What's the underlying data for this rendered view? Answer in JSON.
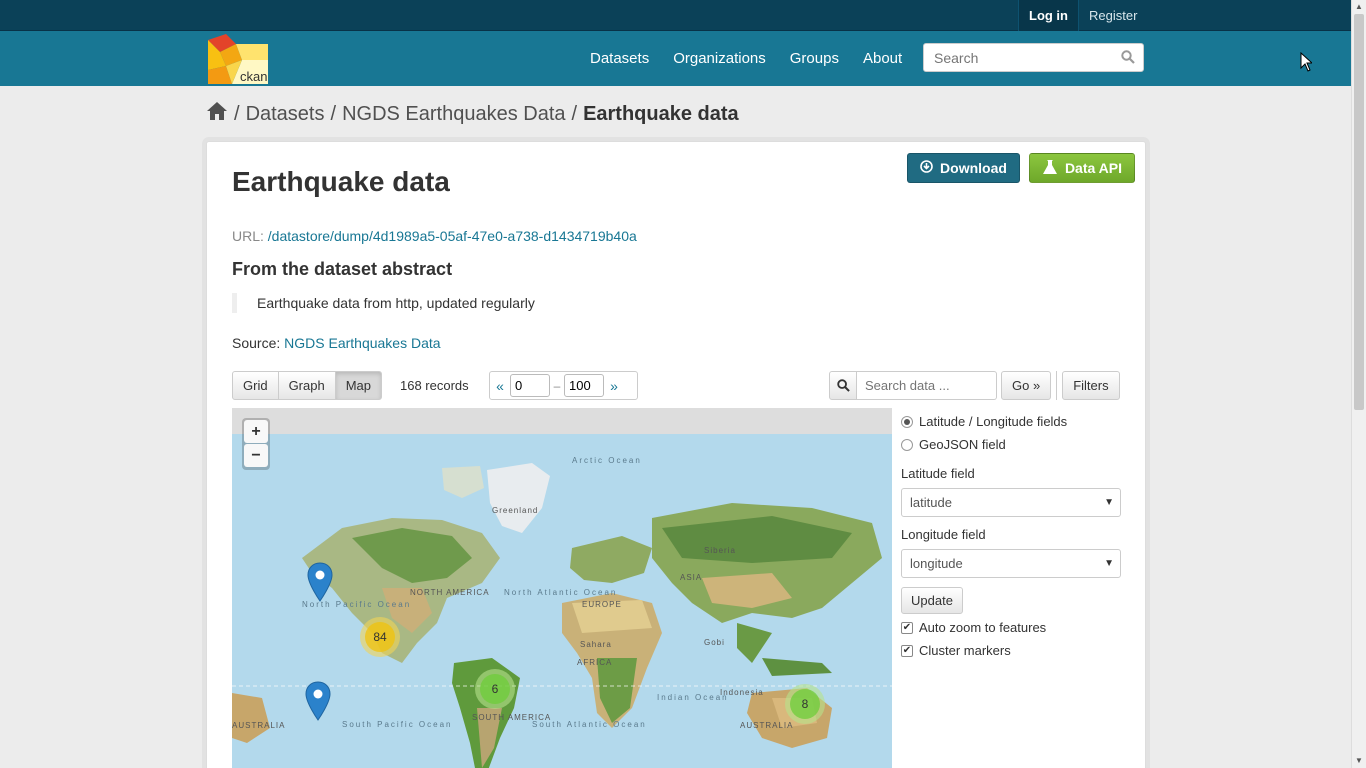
{
  "account": {
    "login": "Log in",
    "register": "Register"
  },
  "nav": {
    "items": [
      "Datasets",
      "Organizations",
      "Groups",
      "About"
    ],
    "search_placeholder": "Search",
    "logo_text": "ckan"
  },
  "breadcrumb": {
    "items": [
      "Datasets",
      "NGDS Earthquakes Data"
    ],
    "active": "Earthquake data",
    "separator": "/"
  },
  "resource": {
    "title": "Earthquake data",
    "download_label": "Download",
    "api_label": "Data API",
    "url_label": "URL:",
    "url": "/datastore/dump/4d1989a5-05af-47e0-a738-d1434719b40a",
    "abstract_heading": "From the dataset abstract",
    "abstract_text": "Earthquake data from http, updated regularly",
    "source_label": "Source:",
    "source_link": "NGDS Earthquakes Data"
  },
  "toolbar": {
    "views": [
      "Grid",
      "Graph",
      "Map"
    ],
    "active_view": "Map",
    "record_count": "168 records",
    "pager_prev": "«",
    "pager_next": "»",
    "pager_from": "0",
    "pager_to": "100",
    "pager_dash": "–",
    "search_placeholder": "Search data ...",
    "go_label": "Go »",
    "filters_label": "Filters"
  },
  "map": {
    "zoom_in": "+",
    "zoom_out": "−",
    "clusters": [
      {
        "count": "84",
        "color": "yellow"
      },
      {
        "count": "6",
        "color": "green"
      },
      {
        "count": "8",
        "color": "green"
      }
    ],
    "labels": {
      "arctic": "Arctic Ocean",
      "greenland": "Greenland",
      "north_america": "NORTH AMERICA",
      "north_pacific": "North Pacific Ocean",
      "north_atlantic": "North Atlantic Ocean",
      "europe": "EUROPE",
      "asia": "ASIA",
      "siberia": "Siberia",
      "africa": "AFRICA",
      "sahara": "Sahara",
      "south_america": "SOUTH AMERICA",
      "australia": "AUSTRALIA",
      "australia_left": "AUSTRALIA",
      "indian": "Indian Ocean",
      "indonesia": "Indonesia",
      "gobi": "Gobi",
      "south_atlantic": "South Atlantic Ocean",
      "south_pacific": "South Pacific Ocean"
    }
  },
  "map_form": {
    "option_latlon": "Latitude / Longitude fields",
    "option_geojson": "GeoJSON field",
    "lat_label": "Latitude field",
    "lat_value": "latitude",
    "lon_label": "Longitude field",
    "lon_value": "longitude",
    "update_label": "Update",
    "auto_zoom": "Auto zoom to features",
    "cluster": "Cluster markers"
  },
  "colors": {
    "masthead": "#187794",
    "account_bar": "#0b4158",
    "download_button": "#206b82",
    "api_button": "#77b02f"
  }
}
